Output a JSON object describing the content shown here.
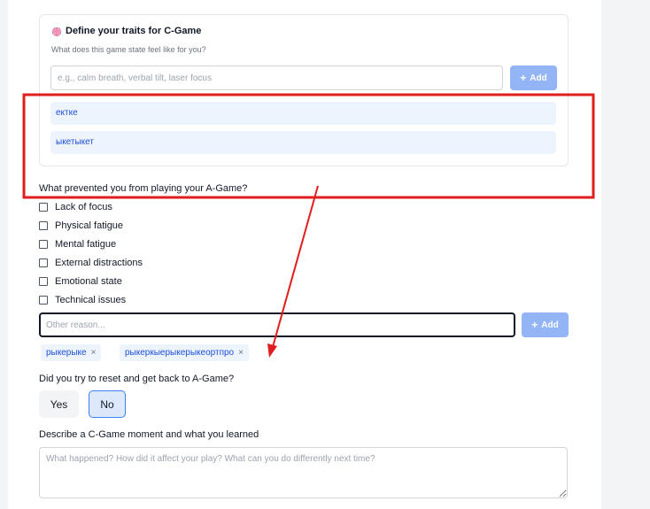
{
  "traits_card": {
    "icon": "brain-icon",
    "title": "Define your traits for C-Game",
    "subtitle": "What does this game state feel like for you?",
    "input_placeholder": "e.g., calm breath, verbal tilt, laser focus",
    "add_label": "Add",
    "traits": [
      "ектке",
      "ыкетыкет"
    ]
  },
  "prevented": {
    "question": "What prevented you from playing your A-Game?",
    "options": [
      {
        "label": "Lack of focus",
        "checked": false
      },
      {
        "label": "Physical fatigue",
        "checked": false
      },
      {
        "label": "Mental fatigue",
        "checked": false
      },
      {
        "label": "External distractions",
        "checked": false
      },
      {
        "label": "Emotional state",
        "checked": false
      },
      {
        "label": "Technical issues",
        "checked": false
      }
    ],
    "other_placeholder": "Other reason...",
    "add_label": "Add",
    "tags": [
      "рыкерыке",
      "рыкеркыерыкерыкеортпро"
    ],
    "remove_glyph": "×"
  },
  "reset": {
    "question": "Did you try to reset and get back to A-Game?",
    "yes_label": "Yes",
    "no_label": "No",
    "selected": "No"
  },
  "describe": {
    "question": "Describe a C-Game moment and what you learned",
    "placeholder": "What happened? How did it affect your play? What can you do differently next time?"
  },
  "annotation": {
    "color": "#e01e1e"
  },
  "colors": {
    "accent": "#3b82f6",
    "add_button": "#93b4f5",
    "trait_bg": "#eef4fd",
    "trait_text": "#1d4ed8"
  }
}
